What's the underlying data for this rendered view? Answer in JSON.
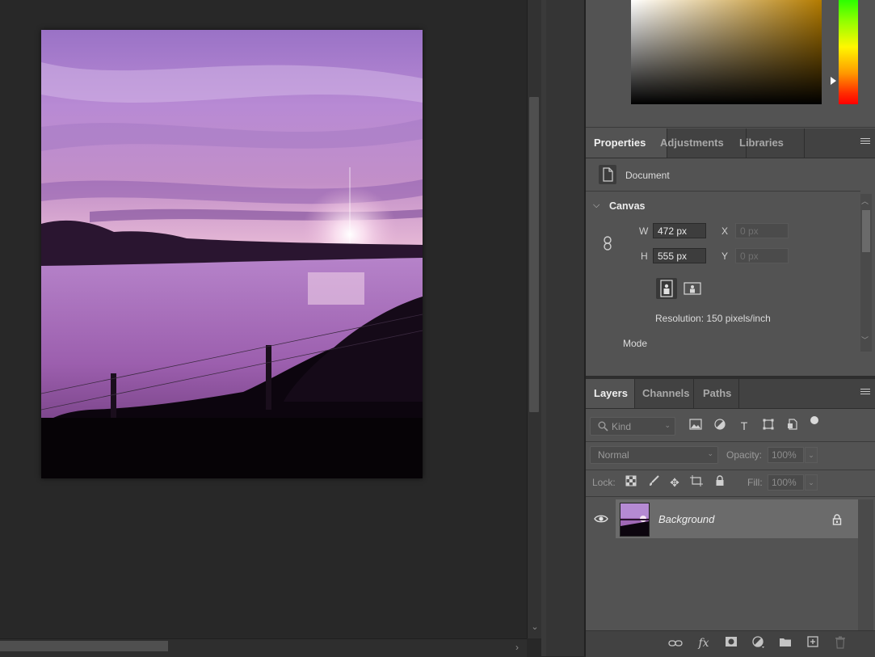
{
  "properties": {
    "tabs": [
      "Properties",
      "Adjustments",
      "Libraries"
    ],
    "document_label": "Document",
    "canvas_section": "Canvas",
    "width_label": "W",
    "width_value": "472 px",
    "height_label": "H",
    "height_value": "555 px",
    "x_label": "X",
    "x_placeholder": "0 px",
    "y_label": "Y",
    "y_placeholder": "0 px",
    "resolution": "Resolution: 150 pixels/inch",
    "mode_label": "Mode"
  },
  "layers": {
    "tabs": [
      "Layers",
      "Channels",
      "Paths"
    ],
    "filter_label": "Kind",
    "blend_mode": "Normal",
    "opacity_label": "Opacity:",
    "opacity_value": "100%",
    "lock_label": "Lock:",
    "fill_label": "Fill:",
    "fill_value": "100%",
    "items": [
      {
        "name": "Background",
        "visible": true,
        "locked": true
      }
    ]
  },
  "colors": {
    "panel_bg": "#535353",
    "canvas_bg": "#282828",
    "hue_base": "#b37b00"
  }
}
